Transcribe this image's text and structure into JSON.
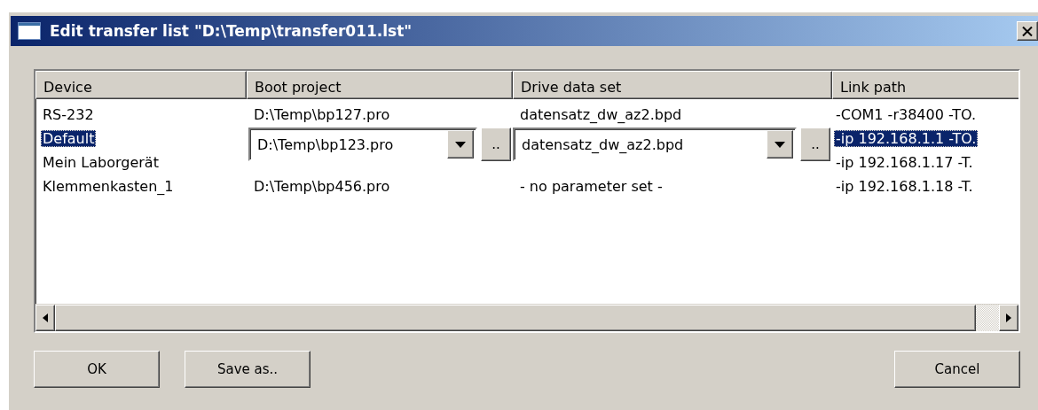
{
  "window": {
    "title": "Edit transfer list \"D:\\Temp\\transfer011.lst\""
  },
  "columns": [
    "Device",
    "Boot project",
    "Drive data set",
    "Link path"
  ],
  "rows": [
    {
      "device": "RS-232",
      "boot_project": "D:\\Temp\\bp127.pro",
      "drive_data_set": "datensatz_dw_az2.bpd",
      "link_path": "-COM1 -r38400 -TO.",
      "selected": false
    },
    {
      "device": "Default",
      "editor": {
        "boot_project": "D:\\Temp\\bp123.pro",
        "drive_data_set": "datensatz_dw_az2.bpd",
        "browse": ".."
      },
      "link_path": "-ip 192.168.1.1 -TO.",
      "selected": true
    },
    {
      "device": "Mein Laborgerät",
      "link_path": "-ip 192.168.1.17 -T.",
      "selected": false
    },
    {
      "device": "Klemmenkasten_1",
      "boot_project": "D:\\Temp\\bp456.pro",
      "drive_data_set": "- no parameter set -",
      "link_path": "-ip 192.168.1.18 -T.",
      "selected": false
    }
  ],
  "buttons": [
    {
      "kind": "left",
      "label": "OK"
    },
    {
      "kind": "left",
      "label": "Save as.."
    },
    {
      "kind": "right",
      "label": "Cancel"
    }
  ]
}
